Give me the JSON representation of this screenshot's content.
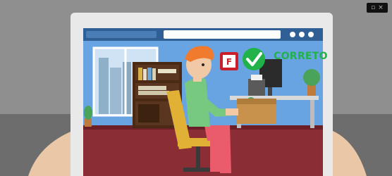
{
  "scene": {
    "feedback_badge": {
      "label": "CORRETO",
      "icon": "check-circle-icon",
      "color": "#21b24a"
    },
    "device": "tablet",
    "illustration": "person-at-desk-illustration"
  },
  "colors": {
    "wall": "#8f8f8f",
    "floor": "#6d6d6d",
    "tablet_frame": "#e9e9ea",
    "browser_bar": "#2f5f95",
    "room_wall": "#69a4e2",
    "room_floor": "#8a2d35",
    "hair": "#f07a2d",
    "shirt": "#77c97f",
    "pants": "#ea5b6b",
    "chair": "#e0b135"
  },
  "player": {
    "controls": [
      "minimize",
      "close"
    ]
  }
}
